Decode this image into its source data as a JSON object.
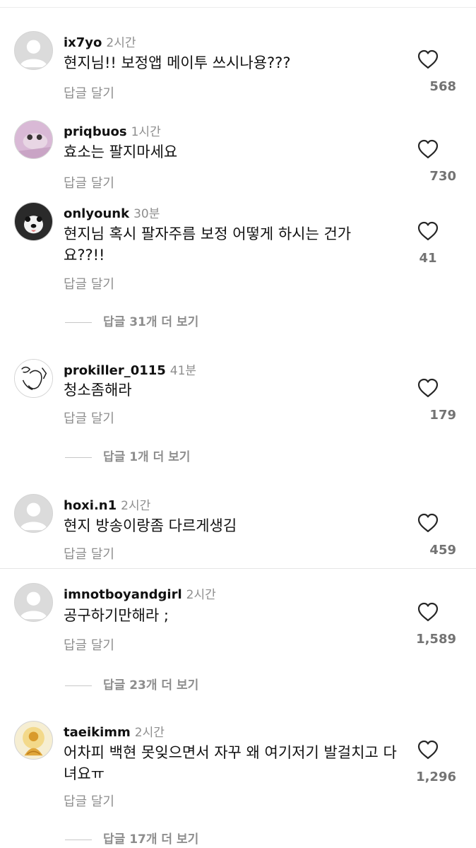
{
  "reply_label": "답글 달기",
  "comments": [
    {
      "username": "ix7yo",
      "time": "2시간",
      "text": "현지님!! 보정앱 메이투 쓰시나용???",
      "likes": "568",
      "avatar_icon": "default-user-icon"
    },
    {
      "username": "priqbuos",
      "time": "1시간",
      "text": "효소는 팔지마세요",
      "likes": "730",
      "avatar_icon": "photo-avatar"
    },
    {
      "username": "onlyounk",
      "time": "30분",
      "text": "현지님 혹시 팔자주름 보정 어떻게 하시는 건가요??!!",
      "likes": "41",
      "avatar_icon": "dog-photo-avatar",
      "more_replies": "답글 31개 더 보기"
    },
    {
      "username": "prokiller_0115",
      "time": "41분",
      "text": "청소좀해라",
      "likes": "179",
      "avatar_icon": "drawing-avatar",
      "more_replies": "답글 1개 더 보기"
    },
    {
      "username": "hoxi.n1",
      "time": "2시간",
      "text": "현지 방송이랑좀 다르게생김",
      "likes": "459",
      "avatar_icon": "default-user-icon"
    },
    {
      "username": "imnotboyandgirl",
      "time": "2시간",
      "text": "공구하기만해라 ;",
      "likes": "1,589",
      "avatar_icon": "default-user-icon",
      "more_replies": "답글 23개 더 보기"
    },
    {
      "username": "taeikimm",
      "time": "2시간",
      "text": "어차피 백현 못잊으면서 자꾸 왜 여기저기 발걸치고 다녀요ㅠ",
      "likes": "1,296",
      "avatar_icon": "buddha-avatar",
      "more_replies": "답글 17개 더 보기"
    }
  ],
  "colors": {
    "username": "#111111",
    "meta": "#8e8e8e",
    "count": "#737373"
  }
}
